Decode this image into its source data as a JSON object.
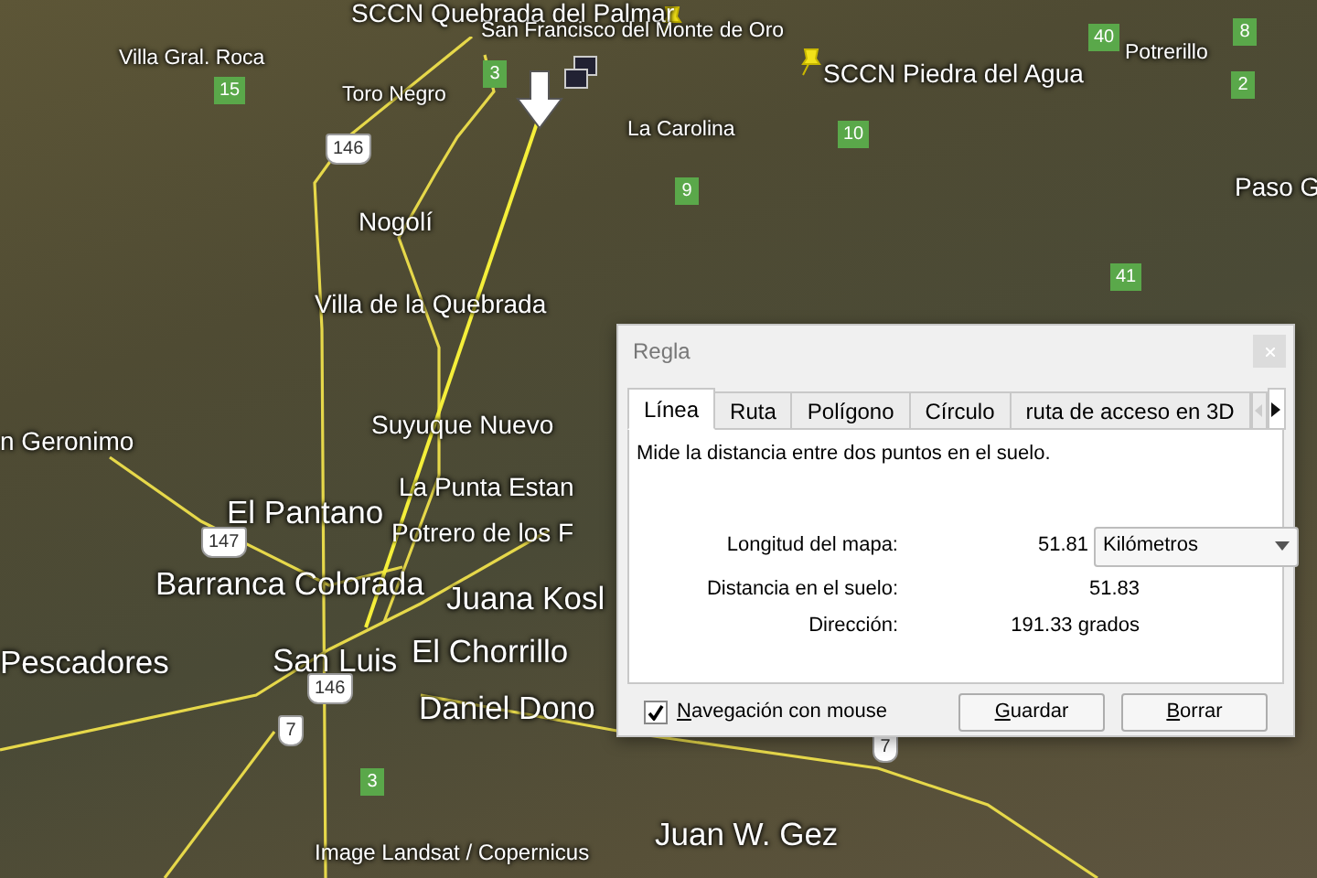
{
  "map": {
    "labels": [
      {
        "text": "SCCN Quebrada del Palmar",
        "kind": "medium"
      },
      {
        "text": "San Francisco del Monte de Oro",
        "kind": "small"
      },
      {
        "text": "SCCN Piedra del Agua",
        "kind": "medium"
      },
      {
        "text": "Potrerillo",
        "kind": "small"
      },
      {
        "text": "La Carolina",
        "kind": "small"
      },
      {
        "text": "Paso G",
        "kind": "medium"
      },
      {
        "text": "Villa Gral. Roca",
        "kind": "small"
      },
      {
        "text": "Toro Negro",
        "kind": "small"
      },
      {
        "text": "Nogolí",
        "kind": "medium"
      },
      {
        "text": "Villa de la Quebrada",
        "kind": "medium"
      },
      {
        "text": "Suyuque Nuevo",
        "kind": "medium"
      },
      {
        "text": "n Geronimo",
        "kind": "medium"
      },
      {
        "text": "La Punta Estan",
        "kind": "medium"
      },
      {
        "text": "El Pantano",
        "kind": "large"
      },
      {
        "text": "Potrero de los F",
        "kind": "medium"
      },
      {
        "text": "Barranca Colorada",
        "kind": "large"
      },
      {
        "text": "Juana Kosl",
        "kind": "large"
      },
      {
        "text": "Pescadores",
        "kind": "large"
      },
      {
        "text": "San Luis",
        "kind": "large"
      },
      {
        "text": "El Chorrillo",
        "kind": "large"
      },
      {
        "text": "Daniel Dono",
        "kind": "large"
      },
      {
        "text": "Juan W. Gez",
        "kind": "large"
      },
      {
        "text": "Image Landsat / Copernicus",
        "kind": "credit"
      }
    ],
    "shields": [
      {
        "text": "15",
        "kind": "provincial"
      },
      {
        "text": "3",
        "kind": "provincial"
      },
      {
        "text": "146",
        "kind": "national"
      },
      {
        "text": "10",
        "kind": "provincial"
      },
      {
        "text": "9",
        "kind": "provincial"
      },
      {
        "text": "40",
        "kind": "provincial"
      },
      {
        "text": "8",
        "kind": "provincial"
      },
      {
        "text": "2",
        "kind": "provincial"
      },
      {
        "text": "41",
        "kind": "provincial"
      },
      {
        "text": "147",
        "kind": "national"
      },
      {
        "text": "146",
        "kind": "national"
      },
      {
        "text": "7",
        "kind": "national"
      },
      {
        "text": "3",
        "kind": "provincial"
      },
      {
        "text": "7",
        "kind": "national"
      }
    ]
  },
  "dialog": {
    "title": "Regla",
    "tabs": [
      {
        "label": "Línea",
        "selected": true
      },
      {
        "label": "Ruta",
        "selected": false
      },
      {
        "label": "Polígono",
        "selected": false
      },
      {
        "label": "Círculo",
        "selected": false
      },
      {
        "label": "ruta de acceso en 3D",
        "selected": false
      }
    ],
    "description": "Mide la distancia entre dos puntos en el suelo.",
    "measurements": [
      {
        "label": "Longitud del mapa:",
        "value": "51.81",
        "unit": "Kilómetros"
      },
      {
        "label": "Distancia en el suelo:",
        "value": "51.83"
      },
      {
        "label": "Dirección:",
        "value": "191.33 grados"
      }
    ],
    "mouse_navigation": {
      "label": "Navegación con mouse",
      "checked": true
    },
    "buttons": [
      "Guardar",
      "Borrar"
    ]
  }
}
